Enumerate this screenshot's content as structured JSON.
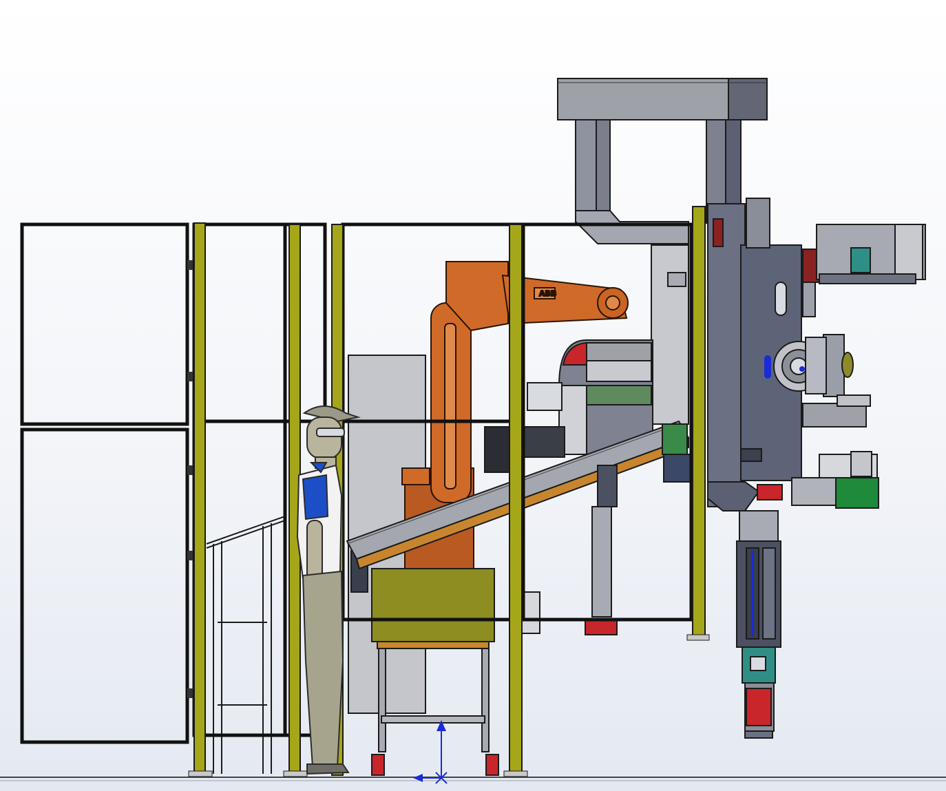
{
  "viewport": {
    "background_top": "#ffffff",
    "background_bottom": "#e4e9f1"
  },
  "colors": {
    "fence_frame": "#111111",
    "fence_glass": "#ecf0f6",
    "yellow_post": "#a6a61a",
    "robot_orange": "#d06a28",
    "steel_grey": "#8b8f99",
    "housing_grey": "#5d6478",
    "cabinet_olive": "#8d8d22",
    "operator_shirt_blue": "#1c4fc7",
    "axis_triad_blue": "#1a2bd8",
    "red_accent": "#c8262a",
    "teal_part": "#2f8f86",
    "green_part": "#1e8a3a"
  },
  "robot": {
    "brand_label": "ABB"
  },
  "components": [
    "safety-fence",
    "fence-door",
    "yellow-fence-post",
    "industrial-robot",
    "conveyor-belt",
    "olive-cabinet",
    "operator-mannequin",
    "overhead-gantry",
    "press-housing",
    "vertical-actuator",
    "coordinate-triad-icon"
  ]
}
